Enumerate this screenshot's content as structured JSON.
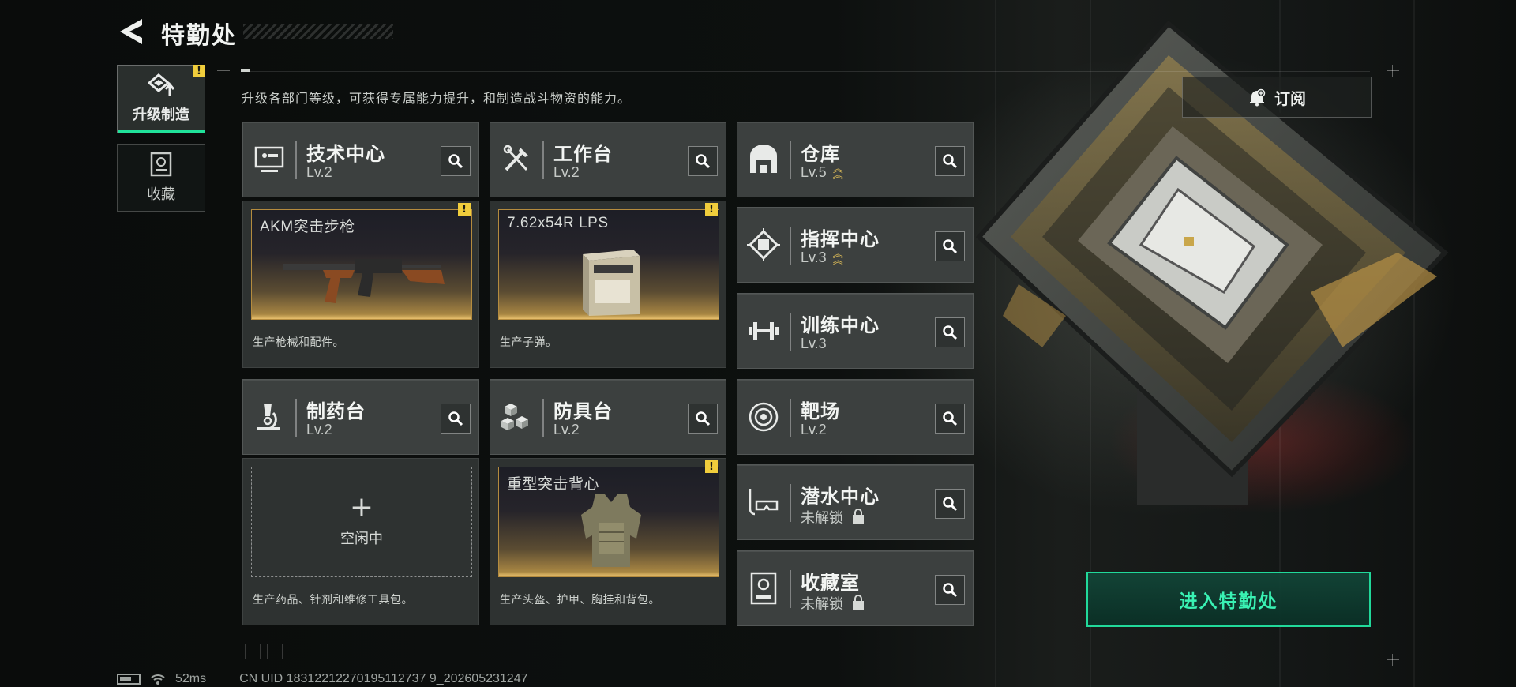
{
  "header": {
    "title": "特勤处"
  },
  "sidebar": {
    "tabs": [
      {
        "label": "升级制造",
        "active": true,
        "alert": "!"
      },
      {
        "label": "收藏",
        "active": false
      }
    ]
  },
  "intro": "升级各部门等级，可获得专属能力提升，和制造战斗物资的能力。",
  "subscribe": {
    "label": "订阅"
  },
  "departments": [
    {
      "name": "技术中心",
      "level": "Lv.2",
      "icon": "computer-icon"
    },
    {
      "name": "工作台",
      "level": "Lv.2",
      "icon": "tools-icon"
    },
    {
      "name": "仓库",
      "level": "Lv.5",
      "icon": "warehouse-icon",
      "upgradable": true
    },
    {
      "name": "指挥中心",
      "level": "Lv.3",
      "icon": "chip-icon",
      "upgradable": true
    },
    {
      "name": "训练中心",
      "level": "Lv.3",
      "icon": "dumbbell-icon"
    },
    {
      "name": "制药台",
      "level": "Lv.2",
      "icon": "microscope-icon"
    },
    {
      "name": "防具台",
      "level": "Lv.2",
      "icon": "armor-blocks-icon"
    },
    {
      "name": "靶场",
      "level": "Lv.2",
      "icon": "target-icon"
    },
    {
      "name": "潜水中心",
      "level": "未解锁",
      "icon": "diving-mask-icon",
      "locked": true
    },
    {
      "name": "收藏室",
      "level": "未解锁",
      "icon": "collection-icon",
      "locked": true
    }
  ],
  "production": [
    {
      "slot_title": "AKM突击步枪",
      "desc": "生产枪械和配件。",
      "alert": "!"
    },
    {
      "slot_title": "7.62x54R LPS",
      "desc": "生产子弹。",
      "alert": "!"
    },
    {
      "slot_title": "",
      "idle_label": "空闲中",
      "desc": "生产药品、针剂和维修工具包。"
    },
    {
      "slot_title": "重型突击背心",
      "desc": "生产头盔、护甲、胸挂和背包。",
      "alert": "!"
    }
  ],
  "enter_button": {
    "label": "进入特勤处"
  },
  "footer": {
    "ping": "52ms",
    "uid": "CN UID 18312212270195112737 9_202605231247"
  },
  "colors": {
    "accent": "#20e29a",
    "warn": "#f0cd3c",
    "gold": "#b48b3e"
  }
}
